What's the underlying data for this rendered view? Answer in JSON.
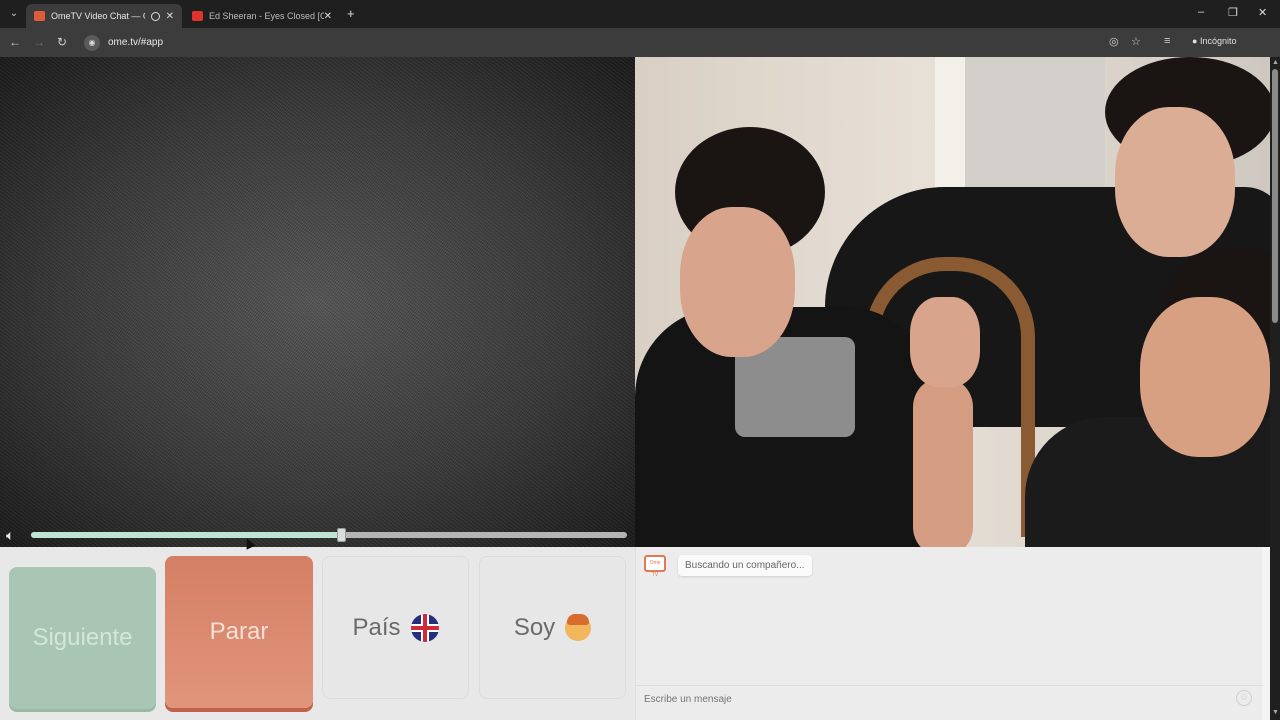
{
  "browser": {
    "tabs": [
      {
        "title": "OmeTV Video Chat — Ome",
        "active": true
      },
      {
        "title": "Ed Sheeran - Eyes Closed [Offic",
        "active": false
      }
    ],
    "new_tab": "+",
    "url": "ome.tv/#app",
    "incognito_label": "Incógnito",
    "window_controls": [
      "–",
      "❐",
      "✕"
    ]
  },
  "player": {
    "progress_fraction": 0.52
  },
  "buttons": {
    "next": "Siguiente",
    "stop": "Parar",
    "country": "País",
    "gender": "Soy"
  },
  "chat": {
    "logo_text": "Ome TV",
    "status_message": "Buscando un compañero...",
    "input_placeholder": "Escribe un mensaje"
  },
  "colors": {
    "next_button": "#a9c6b5",
    "stop_button": "#d47f64",
    "accent_seek": "#bfe4d6"
  }
}
